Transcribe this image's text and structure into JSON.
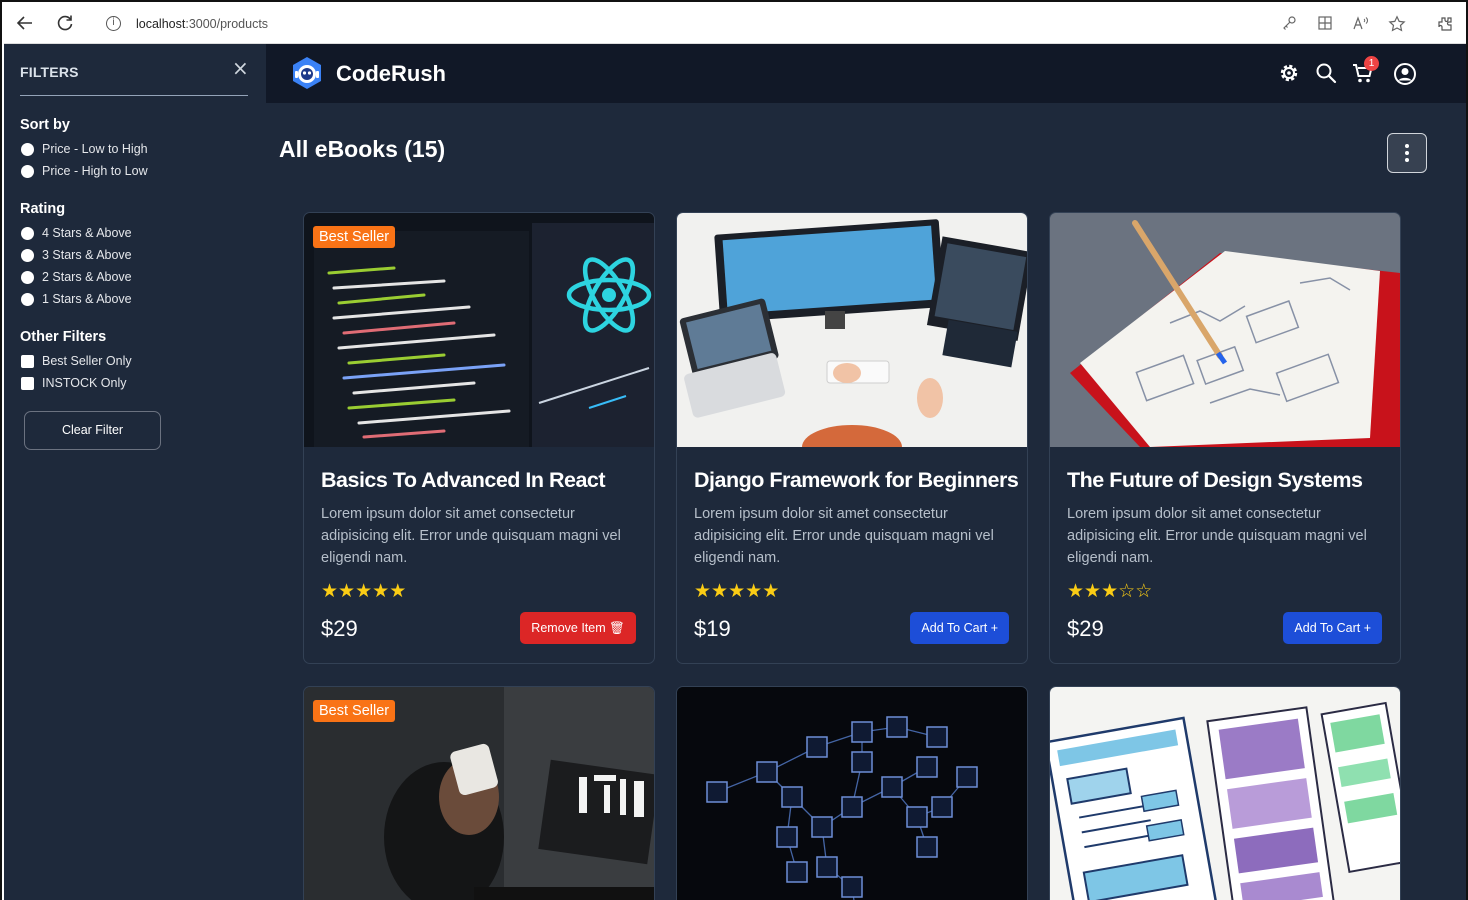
{
  "browser": {
    "url_host": "localhost",
    "url_path": ":3000/products"
  },
  "sidebar": {
    "heading": "FILTERS",
    "close_symbol": "×",
    "sort": {
      "title": "Sort by",
      "options": [
        "Price - Low to High",
        "Price - High to Low"
      ]
    },
    "rating": {
      "title": "Rating",
      "options": [
        "4 Stars & Above",
        "3 Stars & Above",
        "2 Stars & Above",
        "1 Stars & Above"
      ]
    },
    "other": {
      "title": "Other Filters",
      "options": [
        "Best Seller Only",
        "INSTOCK Only"
      ]
    },
    "clear_label": "Clear Filter"
  },
  "header": {
    "brand": "CodeRush",
    "cart_count": "1",
    "icons": [
      "gear-icon",
      "search-icon",
      "cart-icon",
      "user-circle-icon"
    ]
  },
  "main": {
    "title": "All eBooks (15)"
  },
  "products": [
    {
      "title": "Basics To Advanced In React",
      "description": "Lorem ipsum dolor sit amet consectetur adipisicing elit. Error unde quisquam magni vel eligendi nam.",
      "rating": 5,
      "price": "$29",
      "best_seller": "Best Seller",
      "button": "Remove Item",
      "in_cart": true
    },
    {
      "title": "Django Framework for Beginners",
      "description": "Lorem ipsum dolor sit amet consectetur adipisicing elit. Error unde quisquam magni vel eligendi nam.",
      "rating": 5,
      "price": "$19",
      "button": "Add To Cart",
      "in_cart": false
    },
    {
      "title": "The Future of Design Systems",
      "description": "Lorem ipsum dolor sit amet consectetur adipisicing elit. Error unde quisquam magni vel eligendi nam.",
      "rating": 3,
      "price": "$29",
      "button": "Add To Cart",
      "in_cart": false
    },
    {
      "best_seller": "Best Seller"
    },
    {},
    {}
  ],
  "colors": {
    "app_bg": "#1e293b",
    "header_bg": "#111827",
    "accent_blue": "#1d4ed8",
    "danger_red": "#dc2626",
    "badge_orange": "#f97316",
    "star_yellow": "#facc15"
  }
}
